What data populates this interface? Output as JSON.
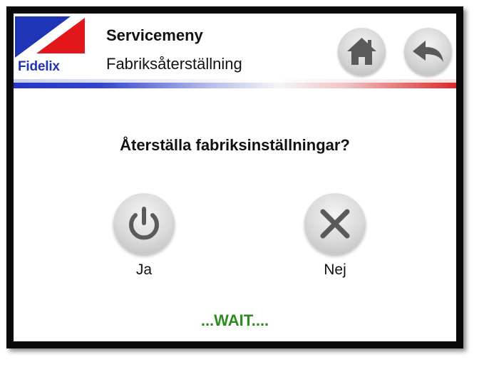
{
  "header": {
    "logo_text": "Fidelix",
    "title": "Servicemeny",
    "subtitle": "Fabriksåterställning",
    "home_icon": "home-icon",
    "back_icon": "back-arrow-icon"
  },
  "dialog": {
    "question": "Återställa fabriksinställningar?",
    "yes_label": "Ja",
    "yes_icon": "power-icon",
    "no_label": "Nej",
    "no_icon": "close-icon",
    "status": "...WAIT...."
  },
  "colors": {
    "logo_blue": "#1f35b8",
    "logo_red": "#e2161b",
    "status_green": "#2e8c1e",
    "button_grey": "#d6d6d6",
    "icon_grey": "#5a5a5a"
  }
}
